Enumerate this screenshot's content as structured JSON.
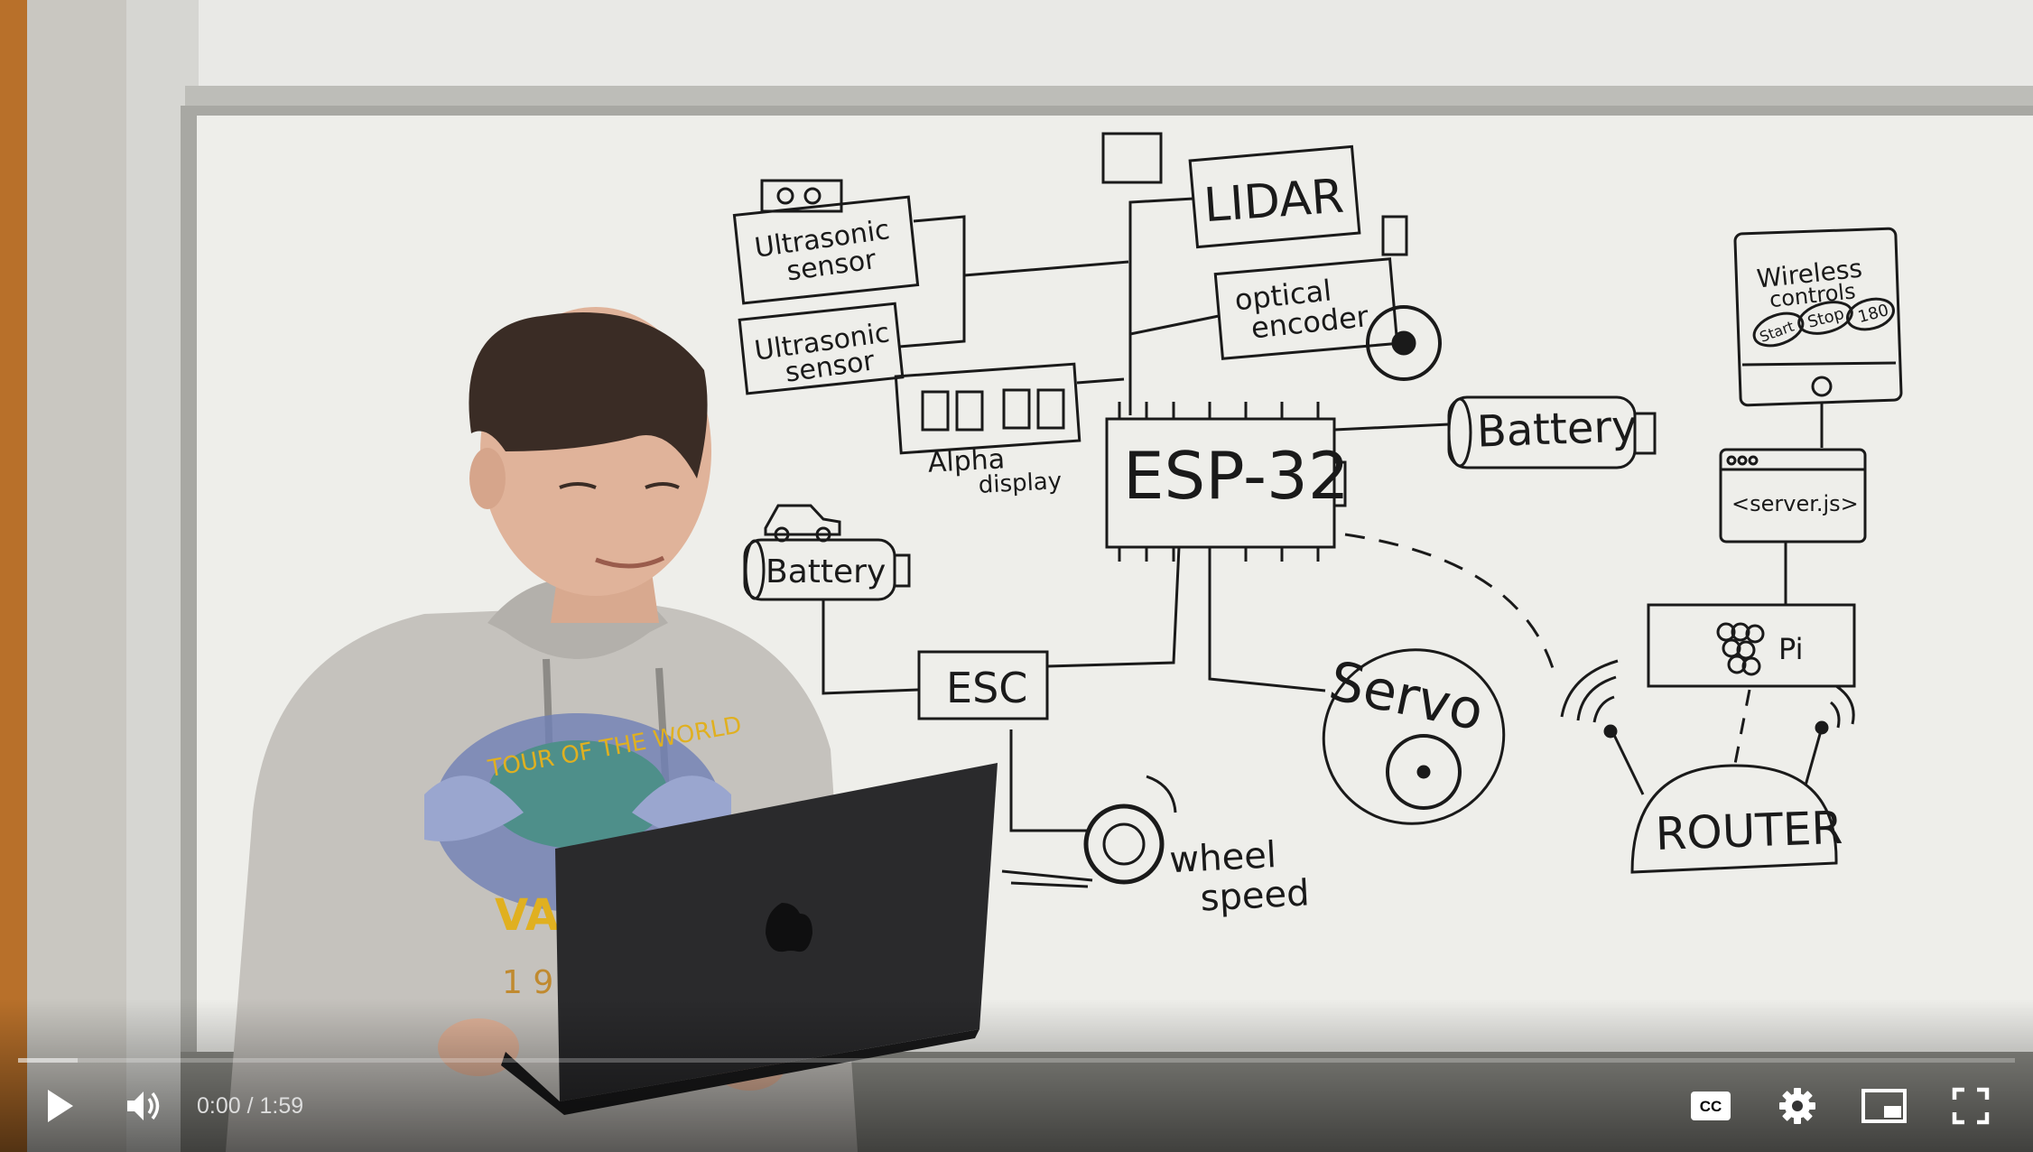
{
  "video": {
    "whiteboard": {
      "ultrasonic_1": [
        "Ultrasonic",
        "sensor"
      ],
      "ultrasonic_2": [
        "Ultrasonic",
        "sensor"
      ],
      "lidar": "LIDAR",
      "optical_encoder": [
        "optical",
        "encoder"
      ],
      "alpha_display": [
        "Alpha",
        "display"
      ],
      "esp32": "ESP-32",
      "battery_right": "Battery",
      "battery_left": "Battery",
      "esc": "ESC",
      "servo": "Servo",
      "wheel_speed": [
        "wheel",
        "speed"
      ],
      "wireless_title": [
        "Wireless",
        "controls"
      ],
      "wireless_buttons": [
        "Start",
        "Stop",
        "180"
      ],
      "server": "<server.js>",
      "pi": "Pi",
      "router": "ROUTER"
    },
    "hoodie_text": [
      "TOUR OF THE WORLD",
      "VAN",
      "1 9"
    ]
  },
  "controls": {
    "current_time": "0:00",
    "separator": " / ",
    "duration": "1:59",
    "progress_played": 0.0,
    "progress_loaded": 0.03,
    "icons": [
      "play-icon",
      "volume-icon",
      "captions-icon",
      "settings-icon",
      "miniplayer-icon",
      "fullscreen-icon"
    ]
  }
}
